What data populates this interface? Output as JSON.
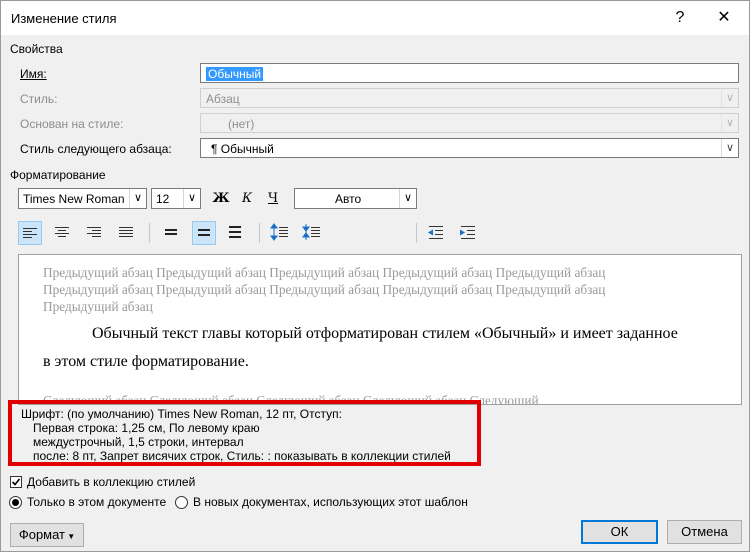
{
  "window": {
    "title": "Изменение стиля",
    "help_label": "?",
    "close_label": "✕"
  },
  "properties": {
    "section_label": "Свойства",
    "name_label": "Имя:",
    "name_value": "Обычный",
    "style_type_label": "Стиль:",
    "style_type_value": "Абзац",
    "based_on_label": "Основан на стиле:",
    "based_on_value": "(нет)",
    "next_style_label": "Стиль следующего абзаца:",
    "next_style_value": "¶  Обычный"
  },
  "formatting": {
    "section_label": "Форматирование",
    "font": "Times New Roman",
    "size": "12",
    "bold": "Ж",
    "italic": "К",
    "underline": "Ч",
    "color": "Авто",
    "icons": [
      "align-left-icon",
      "align-center-icon",
      "align-right-icon",
      "justify-icon",
      "single-spacing-icon",
      "one-half-spacing-icon",
      "double-spacing-icon",
      "increase-paragraph-spacing-icon",
      "decrease-paragraph-spacing-icon",
      "decrease-indent-icon",
      "increase-indent-icon"
    ]
  },
  "preview": {
    "prev_line1": "Предыдущий абзац Предыдущий абзац Предыдущий абзац Предыдущий абзац Предыдущий абзац",
    "prev_line2": "Предыдущий абзац Предыдущий абзац Предыдущий абзац Предыдущий абзац Предыдущий абзац",
    "prev_line3": "Предыдущий абзац",
    "main_line1": "Обычный текст главы который отформатирован стилем «Обычный» и имеет заданное",
    "main_line2": "в этом стиле форматирование.",
    "next_line1": "Следующий абзац Следующий абзац Следующий абзац Следующий абзац Следующий"
  },
  "description": {
    "line1": "Шрифт: (по умолчанию) Times New Roman, 12 пт, Отступ:",
    "line2": "Первая строка:  1,25 см, По левому краю",
    "line3": "междустрочный,  1,5 строки, интервал",
    "line4": "после: 8 пт, Запрет висячих строк, Стиль: : показывать в коллекции стилей"
  },
  "options": {
    "add_to_gallery": "Добавить в коллекцию стилей",
    "only_this_doc": "Только в этом документе",
    "new_docs": "В новых документах, использующих этот шаблон"
  },
  "footer": {
    "format_label": "Формат",
    "ok_label": "ОК",
    "cancel_label": "Отмена"
  },
  "colors": {
    "accent": "#0078d7",
    "highlight": "#e00000",
    "selection": "#3399ff"
  }
}
